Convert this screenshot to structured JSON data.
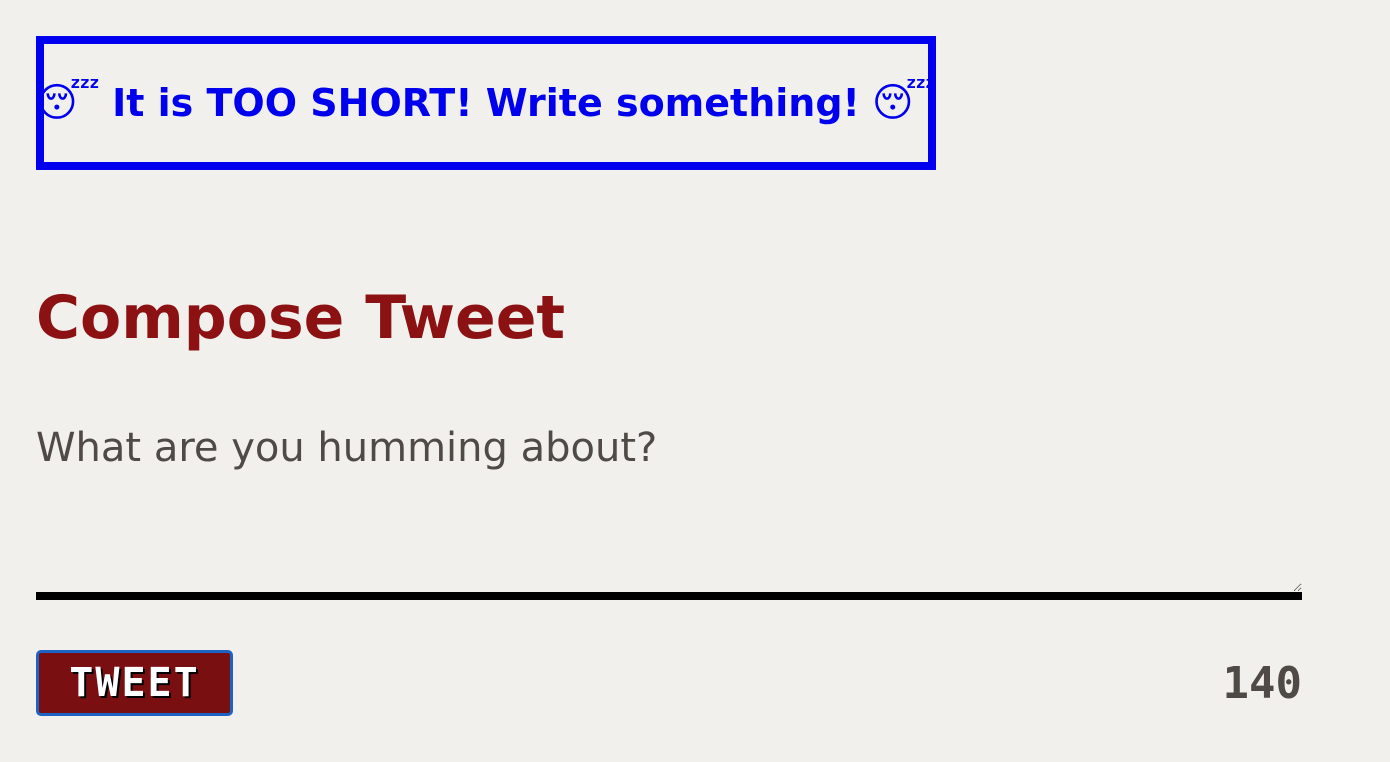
{
  "alert": {
    "icon": "sleeping-face-icon",
    "emoji": "😴",
    "message": "It is TOO SHORT! Write something!",
    "color": "#0000ee"
  },
  "compose": {
    "title": "Compose Tweet",
    "placeholder": "What are you humming about?",
    "value": ""
  },
  "actions": {
    "tweet_label": "TWEET"
  },
  "counter": {
    "remaining": "140"
  },
  "colors": {
    "background": "#f2f0ec",
    "title": "#8b1113",
    "button": "#7a0f12",
    "text": "#4f4a45"
  }
}
